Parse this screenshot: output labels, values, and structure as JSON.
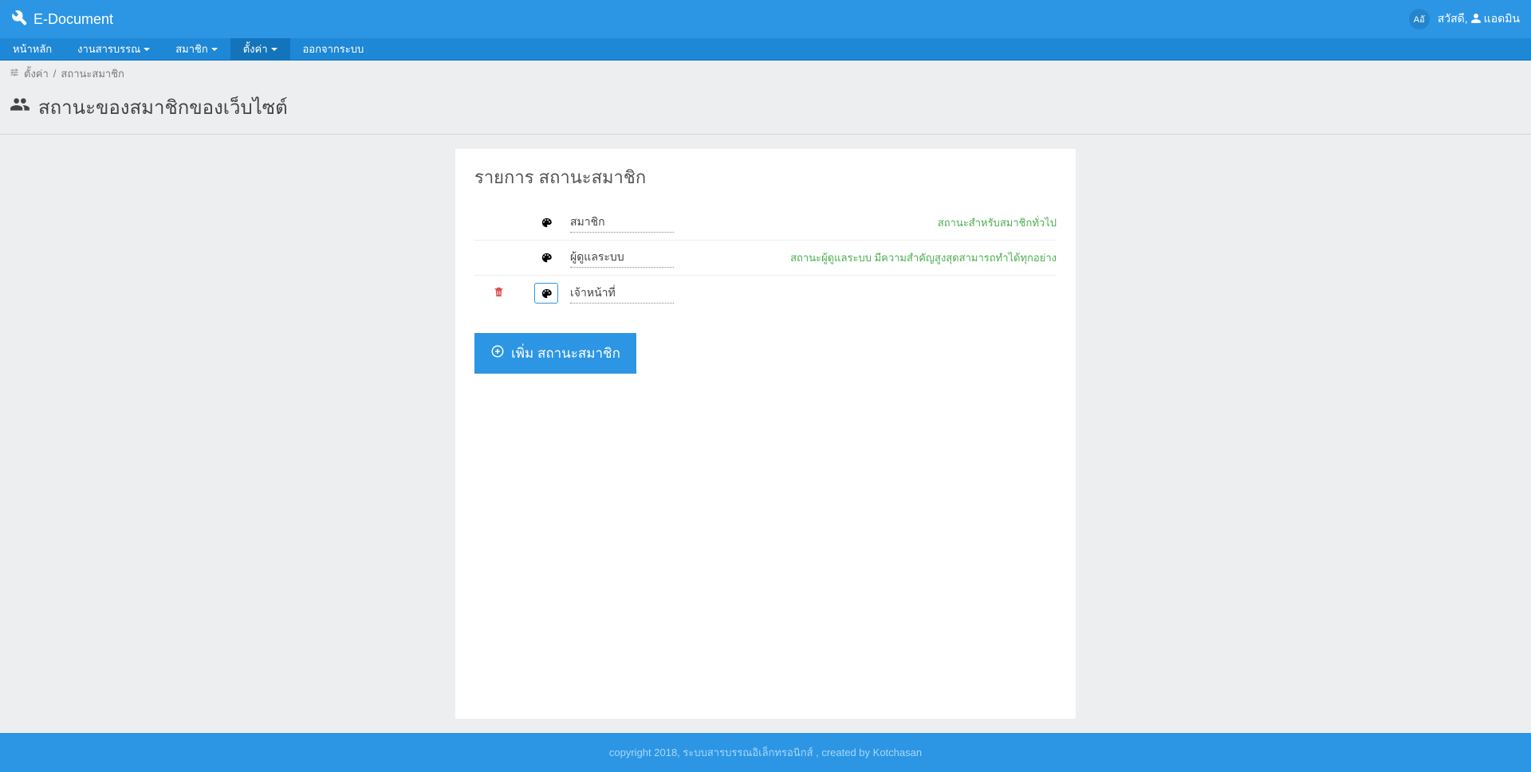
{
  "header": {
    "brand": "E-Document",
    "lang": "Aอั",
    "greet_prefix": "สวัสดี,",
    "user": "แอดมิน"
  },
  "nav": {
    "items": [
      "หน้าหลัก",
      "งานสารบรรณ",
      "สมาชิก",
      "ตั้งค่า",
      "ออกจากระบบ"
    ]
  },
  "breadcrumb": {
    "segment1": "ตั้งค่า",
    "separator": "/",
    "segment2": "สถานะสมาชิก"
  },
  "page": {
    "title": "สถานะของสมาชิกของเว็บไซต์"
  },
  "panel": {
    "title": "รายการ สถานะสมาชิก",
    "rows": [
      {
        "deletable": false,
        "selected": false,
        "name": "สมาชิก",
        "desc": "สถานะสำหรับสมาชิกทั่วไป"
      },
      {
        "deletable": false,
        "selected": false,
        "name": "ผู้ดูแลระบบ",
        "desc": "สถานะผู้ดูแลระบบ มีความสำคัญสูงสุดสามารถทำได้ทุกอย่าง"
      },
      {
        "deletable": true,
        "selected": true,
        "name": "เจ้าหน้าที่",
        "desc": ""
      }
    ],
    "add_button": "เพิ่ม สถานะสมาชิก"
  },
  "footer": {
    "text": "copyright 2018, ระบบสารบรรณอิเล็กทรอนิกส์ , created by Kotchasan"
  }
}
